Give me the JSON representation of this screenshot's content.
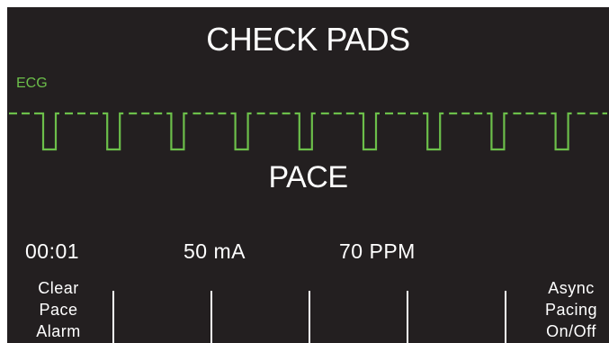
{
  "header": {
    "title": "CHECK PADS"
  },
  "ecg": {
    "label": "ECG",
    "color": "#6cbf4a",
    "pulse_count": 9
  },
  "mode": {
    "label": "PACE"
  },
  "readouts": {
    "elapsed": "00:01",
    "current": "50 mA",
    "rate": "70 PPM"
  },
  "softkeys": {
    "left": {
      "lines": [
        "Clear",
        "Pace",
        "Alarm"
      ]
    },
    "right": {
      "lines": [
        "Async",
        "Pacing",
        "On/Off"
      ]
    }
  }
}
